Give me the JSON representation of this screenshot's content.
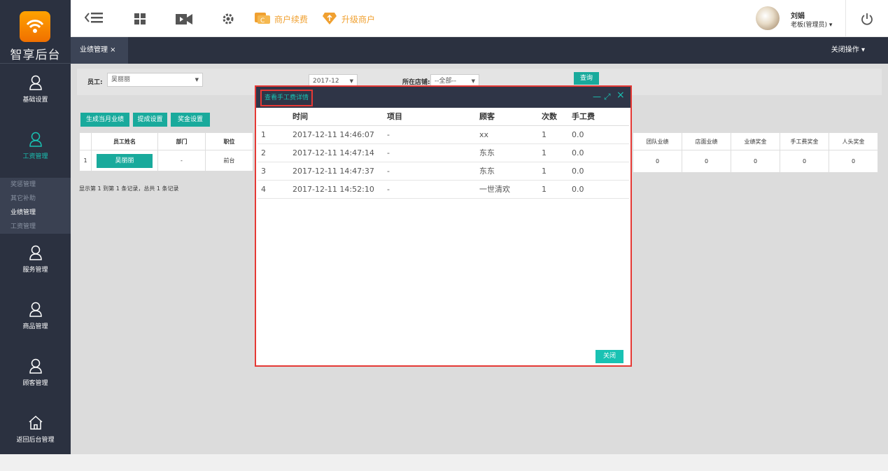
{
  "sidebar": {
    "title": "智享后台",
    "items": [
      {
        "label": "基础设置"
      },
      {
        "label": "工资管理"
      },
      {
        "label": "服务管理"
      },
      {
        "label": "商品管理"
      },
      {
        "label": "顾客管理"
      },
      {
        "label": "返回后台管理"
      }
    ],
    "submenu": [
      "奖惩管理",
      "其它补助",
      "业绩管理",
      "工资管理"
    ]
  },
  "topbar": {
    "renew_label": "商户续费",
    "upgrade_label": "升级商户",
    "user_name": "刘娟",
    "user_role": "老板(管理员) ▾"
  },
  "tabbar": {
    "active_tab": "业绩管理 ×",
    "close_ops": "关闭操作 ▾"
  },
  "filter": {
    "employee_label": "员工:",
    "employee_value": "吴丽丽",
    "month_value": "2017-12",
    "store_label": "所在店铺:",
    "store_value": "--全部--",
    "query_label": "查询"
  },
  "actions": {
    "generate_label": "生成当月业绩",
    "commission_label": "提成设置",
    "bonus_label": "奖金设置"
  },
  "bg_table": {
    "headers": [
      "员工姓名",
      "部门",
      "职位"
    ],
    "row": {
      "index": "1",
      "name": "吴丽丽",
      "dept": "-",
      "position": "前台"
    },
    "right_headers": [
      "团队业绩",
      "店面业绩",
      "业绩奖金",
      "手工费奖金",
      "人头奖金"
    ],
    "right_values": [
      "0",
      "0",
      "0",
      "0",
      "0"
    ]
  },
  "pager_text": "显示第 1 到第 1 条记录，总共 1 条记录",
  "modal": {
    "title": "查看手工费详情",
    "headers": [
      "时间",
      "项目",
      "顾客",
      "次数",
      "手工费"
    ],
    "rows": [
      {
        "idx": "1",
        "time": "2017-12-11 14:46:07",
        "item": "-",
        "customer": "xx",
        "count": "1",
        "fee": "0.0"
      },
      {
        "idx": "2",
        "time": "2017-12-11 14:47:14",
        "item": "-",
        "customer": "东东",
        "count": "1",
        "fee": "0.0"
      },
      {
        "idx": "3",
        "time": "2017-12-11 14:47:37",
        "item": "-",
        "customer": "东东",
        "count": "1",
        "fee": "0.0"
      },
      {
        "idx": "4",
        "time": "2017-12-11 14:52:10",
        "item": "-",
        "customer": "一世清欢",
        "count": "1",
        "fee": "0.0"
      }
    ],
    "close_label": "关闭",
    "minimize_glyph": "—",
    "maximize_glyph": "⤢",
    "close_glyph": "×"
  },
  "colors": {
    "accent": "#19c2b3",
    "sidebar": "#2b3140",
    "highlight": "#e53935",
    "warn": "#f0a030"
  }
}
